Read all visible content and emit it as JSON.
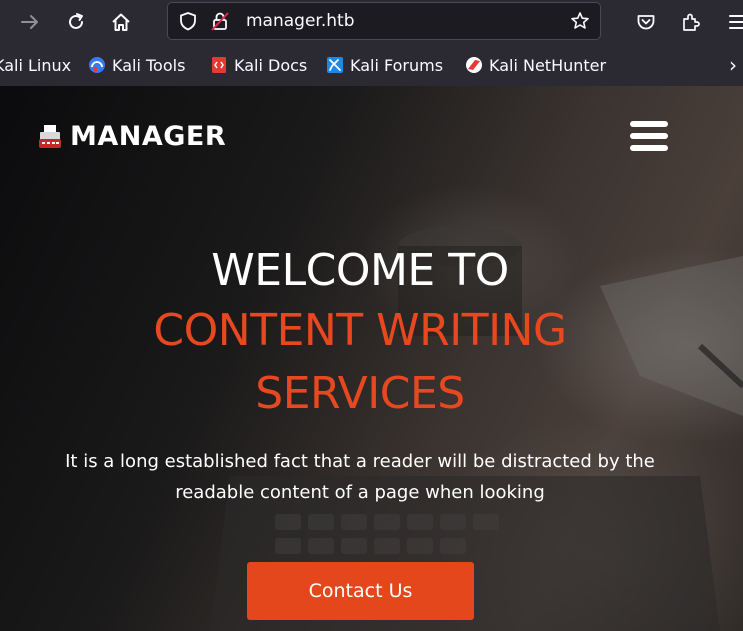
{
  "browser": {
    "url": "manager.htb",
    "bookmarks": [
      {
        "label": "Kali Linux",
        "icon": "kali-linux-icon"
      },
      {
        "label": "Kali Tools",
        "icon": "kali-tools-icon"
      },
      {
        "label": "Kali Docs",
        "icon": "kali-docs-icon"
      },
      {
        "label": "Kali Forums",
        "icon": "kali-forums-icon"
      },
      {
        "label": "Kali NetHunter",
        "icon": "kali-nethunter-icon"
      }
    ],
    "overflow_glyph": "›"
  },
  "site": {
    "brand": "MANAGER",
    "headline_line1": "WELCOME TO",
    "headline_line2": "CONTENT WRITING",
    "headline_line3": "SERVICES",
    "subtitle": "It is a long established fact that a reader will be distracted by the readable content of a page when looking",
    "cta_label": "Contact Us",
    "colors": {
      "accent": "#e5471c",
      "headline_accent": "#e8481f",
      "text": "#ffffff"
    }
  }
}
